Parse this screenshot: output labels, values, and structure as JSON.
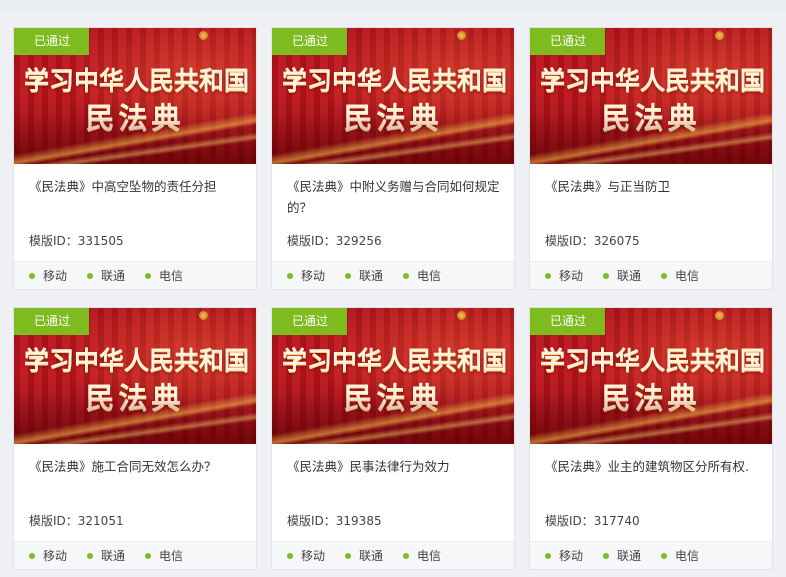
{
  "status_badge_label": "已通过",
  "banner": {
    "line1": "学习中华人民共和国",
    "line2": "民法典"
  },
  "id_prefix": "模版ID：",
  "carriers": [
    "移动",
    "联通",
    "电信"
  ],
  "colors": {
    "badge": "#7dbb1f",
    "banner_red": "#c2151d",
    "carrier_dot": "#7dbb1f"
  },
  "cards": [
    {
      "title": "《民法典》中高空坠物的责任分担",
      "id": "331505"
    },
    {
      "title": "《民法典》中附义务赠与合同如何规定的？",
      "id": "329256"
    },
    {
      "title": "《民法典》与正当防卫",
      "id": "326075"
    },
    {
      "title": "《民法典》施工合同无效怎么办？",
      "id": "321051"
    },
    {
      "title": "《民法典》民事法律行为效力",
      "id": "319385"
    },
    {
      "title": "《民法典》业主的建筑物区分所有权.",
      "id": "317740"
    }
  ]
}
